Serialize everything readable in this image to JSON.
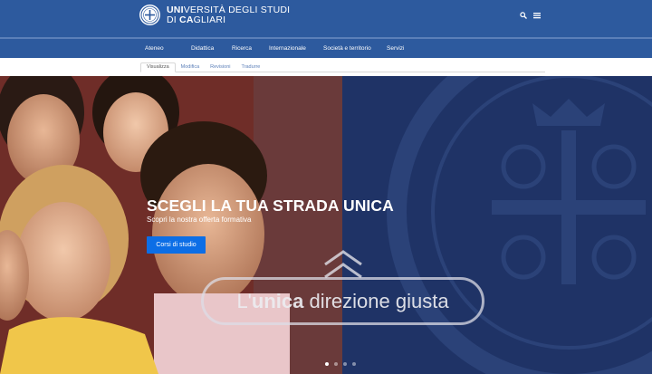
{
  "header": {
    "brand_line1_bold": "UNI",
    "brand_line1_rest": "VERSITÀ DEGLI STUDI",
    "brand_line2_pre": "DI ",
    "brand_line2_bold": "CA",
    "brand_line2_rest": "GLIARI",
    "icons": [
      "search-icon",
      "menu-icon"
    ]
  },
  "nav": {
    "items": [
      {
        "label": "Ateneo"
      },
      {
        "label": "Didattica"
      },
      {
        "label": "Ricerca"
      },
      {
        "label": "Internazionale"
      },
      {
        "label": "Società e territorio"
      },
      {
        "label": "Servizi"
      }
    ]
  },
  "tabs": [
    {
      "label": "Visualizza",
      "active": true
    },
    {
      "label": "Modifica"
    },
    {
      "label": "Revisioni"
    },
    {
      "label": "Tradurre"
    }
  ],
  "hero": {
    "title": "SCEGLI LA TUA STRADA UNICA",
    "subtitle": "Scopri la nostra offerta formativa",
    "button": "Corsi di studio",
    "motto_pre": "L'",
    "motto_bold": "unica",
    "motto_rest": " direzione giusta",
    "slides": 4,
    "active_slide": 1
  },
  "colors": {
    "header_bg": "#2d5a9e",
    "cta": "#0c6ee6",
    "hero_navy": "#1f3366"
  }
}
